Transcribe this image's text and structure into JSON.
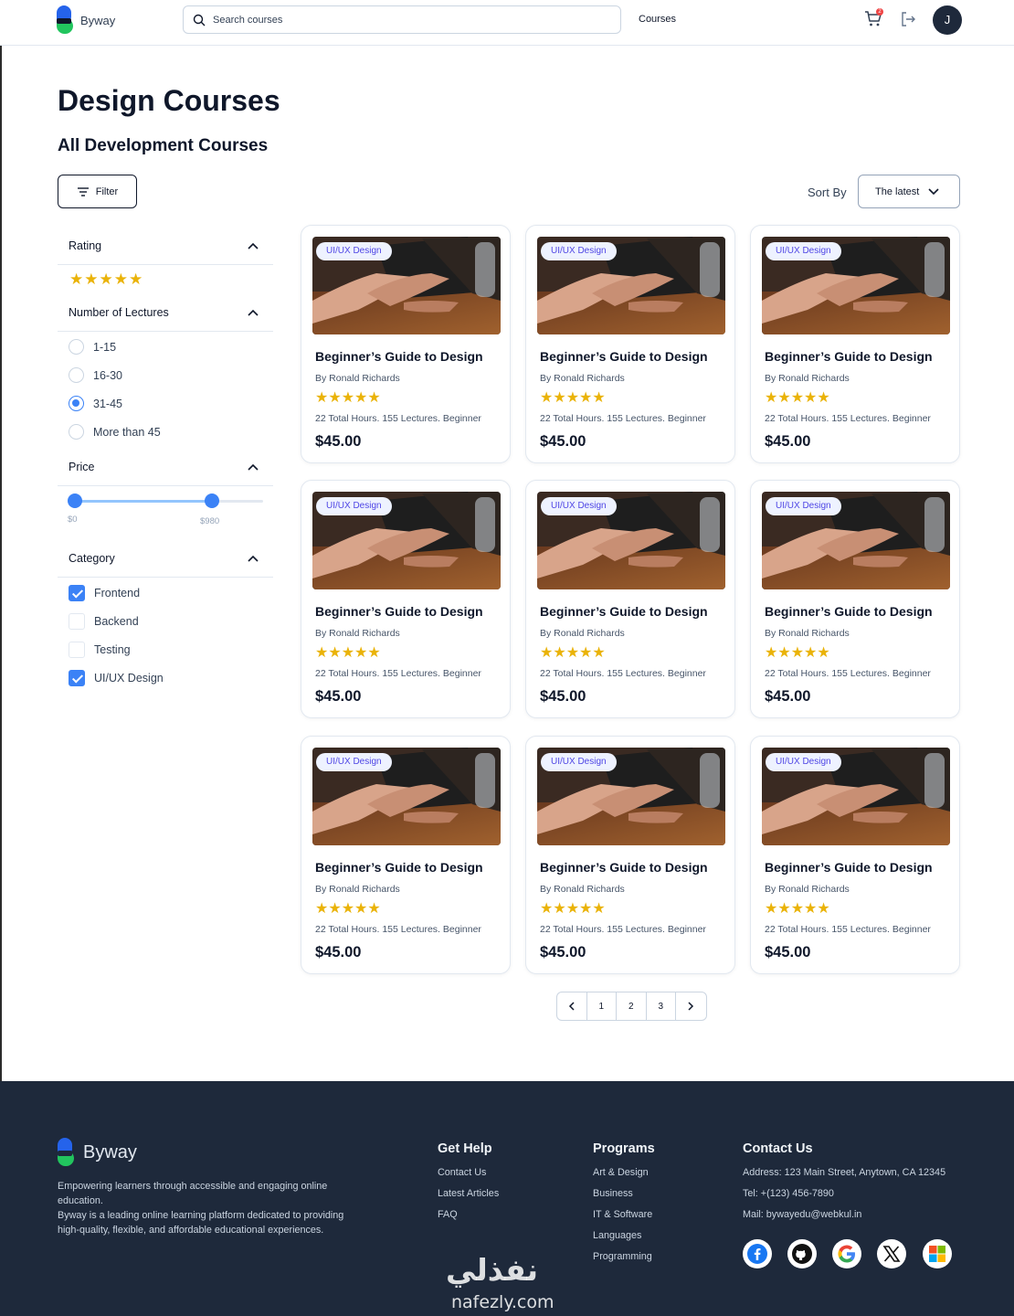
{
  "header": {
    "logo_text": "Byway",
    "search_placeholder": "Search courses",
    "nav_courses": "Courses",
    "cart_count": "2",
    "avatar_initial": "J"
  },
  "page": {
    "title": "Design Courses",
    "subtitle": "All Development Courses",
    "filter_label": "Filter",
    "sort_label": "Sort By",
    "sort_value": "The latest"
  },
  "sidebar": {
    "rating_title": "Rating",
    "rating_stars": 5,
    "lectures_title": "Number of Lectures",
    "lecture_options": [
      {
        "label": "1-15",
        "selected": false
      },
      {
        "label": "16-30",
        "selected": false
      },
      {
        "label": "31-45",
        "selected": true
      },
      {
        "label": "More than 45",
        "selected": false
      }
    ],
    "price_title": "Price",
    "price_min": "$0",
    "price_max": "$980",
    "category_title": "Category",
    "categories": [
      {
        "label": "Frontend",
        "checked": true
      },
      {
        "label": "Backend",
        "checked": false
      },
      {
        "label": "Testing",
        "checked": false
      },
      {
        "label": "UI/UX Design",
        "checked": true
      }
    ]
  },
  "courses": [
    {
      "tag": "UI/UX Design",
      "title": "Beginner’s Guide to Design",
      "author": "By Ronald Richards",
      "rating": 5,
      "meta": "22 Total Hours. 155 Lectures. Beginner",
      "price": "$45.00"
    },
    {
      "tag": "UI/UX Design",
      "title": "Beginner’s Guide to Design",
      "author": "By Ronald Richards",
      "rating": 5,
      "meta": "22 Total Hours. 155 Lectures. Beginner",
      "price": "$45.00"
    },
    {
      "tag": "UI/UX Design",
      "title": "Beginner’s Guide to Design",
      "author": "By Ronald Richards",
      "rating": 5,
      "meta": "22 Total Hours. 155 Lectures. Beginner",
      "price": "$45.00"
    },
    {
      "tag": "UI/UX Design",
      "title": "Beginner’s Guide to Design",
      "author": "By Ronald Richards",
      "rating": 5,
      "meta": "22 Total Hours. 155 Lectures. Beginner",
      "price": "$45.00"
    },
    {
      "tag": "UI/UX Design",
      "title": "Beginner’s Guide to Design",
      "author": "By Ronald Richards",
      "rating": 5,
      "meta": "22 Total Hours. 155 Lectures. Beginner",
      "price": "$45.00"
    },
    {
      "tag": "UI/UX Design",
      "title": "Beginner’s Guide to Design",
      "author": "By Ronald Richards",
      "rating": 5,
      "meta": "22 Total Hours. 155 Lectures. Beginner",
      "price": "$45.00"
    },
    {
      "tag": "UI/UX Design",
      "title": "Beginner’s Guide to Design",
      "author": "By Ronald Richards",
      "rating": 5,
      "meta": "22 Total Hours. 155 Lectures. Beginner",
      "price": "$45.00"
    },
    {
      "tag": "UI/UX Design",
      "title": "Beginner’s Guide to Design",
      "author": "By Ronald Richards",
      "rating": 5,
      "meta": "22 Total Hours. 155 Lectures. Beginner",
      "price": "$45.00"
    },
    {
      "tag": "UI/UX Design",
      "title": "Beginner’s Guide to Design",
      "author": "By Ronald Richards",
      "rating": 5,
      "meta": "22 Total Hours. 155 Lectures. Beginner",
      "price": "$45.00"
    }
  ],
  "pagination": {
    "prev_icon": "chevron-left-icon",
    "pages": [
      "1",
      "2",
      "3"
    ],
    "next_icon": "chevron-right-icon"
  },
  "footer": {
    "logo_text": "Byway",
    "description": "Empowering learners through accessible and engaging online education.\nByway is a leading online learning platform dedicated to providing high-quality, flexible, and affordable educational experiences.",
    "columns": [
      {
        "title": "Get Help",
        "links": [
          "Contact Us",
          "Latest Articles",
          "FAQ"
        ]
      },
      {
        "title": "Programs",
        "links": [
          "Art & Design",
          "Business",
          "IT & Software",
          "Languages",
          "Programming"
        ]
      },
      {
        "title": "Contact Us",
        "links": [
          "Address: 123 Main Street, Anytown, CA 12345",
          "Tel: +(123) 456-7890",
          "Mail: bywayedu@webkul.in"
        ]
      }
    ],
    "socials": [
      "facebook-icon",
      "github-icon",
      "google-icon",
      "x-icon",
      "microsoft-icon"
    ]
  },
  "watermark": {
    "arabic": "نفذلي",
    "latin": "nafezly.com"
  },
  "colors": {
    "accent": "#3b82f6",
    "star": "#eab308",
    "footer_bg": "#1e293b",
    "tag_bg": "#eef2ff",
    "tag_text": "#4f46e5"
  }
}
